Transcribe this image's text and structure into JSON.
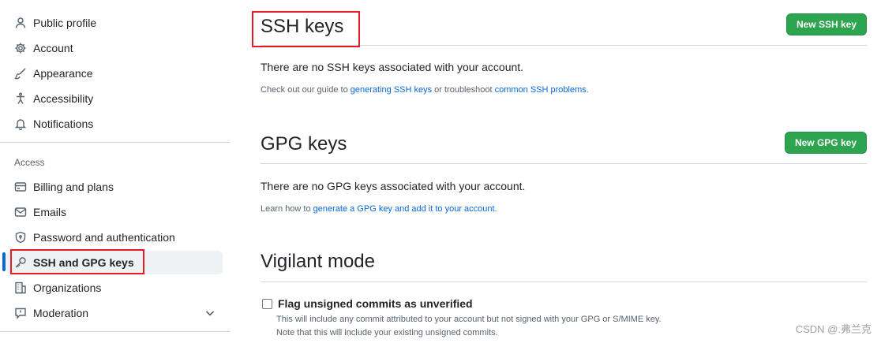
{
  "sidebar": {
    "items": [
      {
        "label": "Public profile",
        "icon": "person-icon"
      },
      {
        "label": "Account",
        "icon": "gear-icon"
      },
      {
        "label": "Appearance",
        "icon": "paintbrush-icon"
      },
      {
        "label": "Accessibility",
        "icon": "accessibility-icon"
      },
      {
        "label": "Notifications",
        "icon": "bell-icon"
      }
    ],
    "access_label": "Access",
    "access_items": [
      {
        "label": "Billing and plans",
        "icon": "credit-card-icon"
      },
      {
        "label": "Emails",
        "icon": "mail-icon"
      },
      {
        "label": "Password and authentication",
        "icon": "shield-lock-icon"
      },
      {
        "label": "SSH and GPG keys",
        "icon": "key-icon",
        "active": true
      },
      {
        "label": "Organizations",
        "icon": "organization-icon"
      },
      {
        "label": "Moderation",
        "icon": "report-icon"
      }
    ]
  },
  "ssh": {
    "title": "SSH keys",
    "new_button": "New SSH key",
    "empty_text": "There are no SSH keys associated with your account.",
    "guide_prefix": "Check out our guide to ",
    "guide_link1": "generating SSH keys",
    "guide_middle": " or troubleshoot ",
    "guide_link2": "common SSH problems",
    "guide_suffix": "."
  },
  "gpg": {
    "title": "GPG keys",
    "new_button": "New GPG key",
    "empty_text": "There are no GPG keys associated with your account.",
    "learn_prefix": "Learn how to ",
    "learn_link": "generate a GPG key and add it to your account",
    "learn_suffix": "."
  },
  "vigilant": {
    "title": "Vigilant mode",
    "checkbox_label": "Flag unsigned commits as unverified",
    "checked": false,
    "note1": "This will include any commit attributed to your account but not signed with your GPG or S/MIME key.",
    "note2": "Note that this will include your existing unsigned commits."
  },
  "watermark": "CSDN @.弗兰克",
  "colors": {
    "accent": "#0969da",
    "button_green": "#2da44e",
    "highlight_red": "#e31b23"
  }
}
